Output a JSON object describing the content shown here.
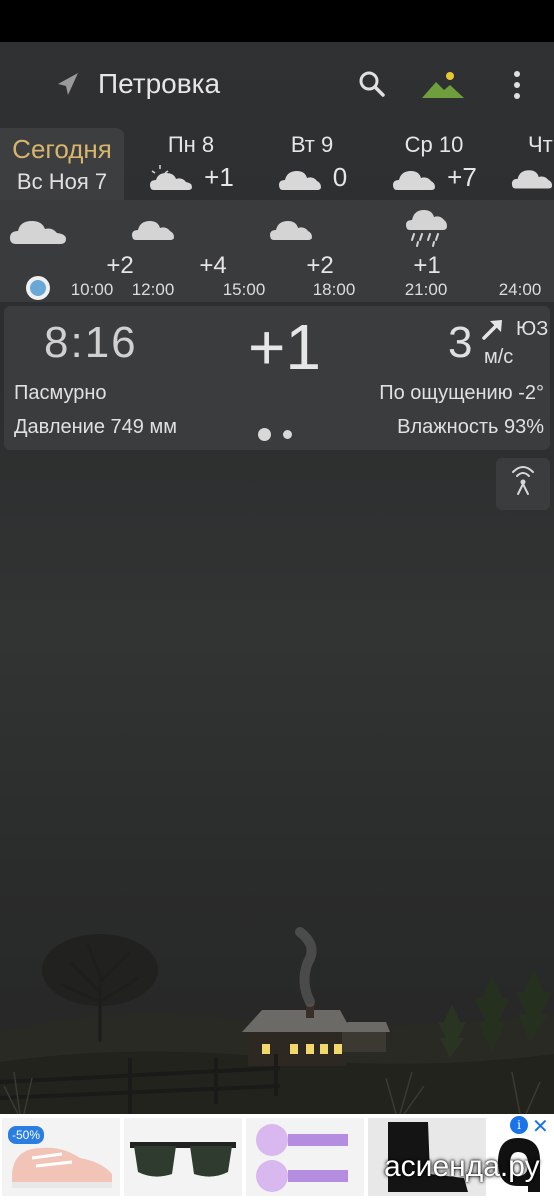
{
  "location": {
    "name": "Петровка"
  },
  "colors": {
    "today_accent": "#d7b56d",
    "now_dot": "#6aa8d8",
    "ad_info": "#1a73e8"
  },
  "days": [
    {
      "name": "Сегодня",
      "date": "Вс Ноя 7",
      "selected": true
    },
    {
      "label": "Пн 8",
      "temp": "+1",
      "icon": "partly-cloudy-icon"
    },
    {
      "label": "Вт 9",
      "temp": "0",
      "icon": "cloud-icon"
    },
    {
      "label": "Ср 10",
      "temp": "+7",
      "icon": "cloud-icon"
    },
    {
      "label": "Чт",
      "temp": "",
      "icon": "cloud-icon"
    }
  ],
  "hourly": {
    "temps": [
      "+2",
      "+4",
      "+2",
      "+1"
    ],
    "times": [
      "10:00",
      "12:00",
      "15:00",
      "18:00",
      "21:00",
      "24:00"
    ],
    "icons": [
      "cloud-icon",
      "cloud-icon",
      "cloud-icon",
      "rain-cloud-icon"
    ]
  },
  "current": {
    "time": "8:16",
    "temp": "+1",
    "wind_speed": "3",
    "wind_dir": "ЮЗ",
    "wind_unit": "м/с",
    "condition": "Пасмурно",
    "feels_like": "По ощущению -2°",
    "pressure": "Давление 749 мм",
    "humidity": "Влажность 93%",
    "pages": 2,
    "active_page": 1
  },
  "ad": {
    "badge": "-50%",
    "wordmark": "асиенда.ру",
    "info": "i",
    "close": "✕"
  }
}
